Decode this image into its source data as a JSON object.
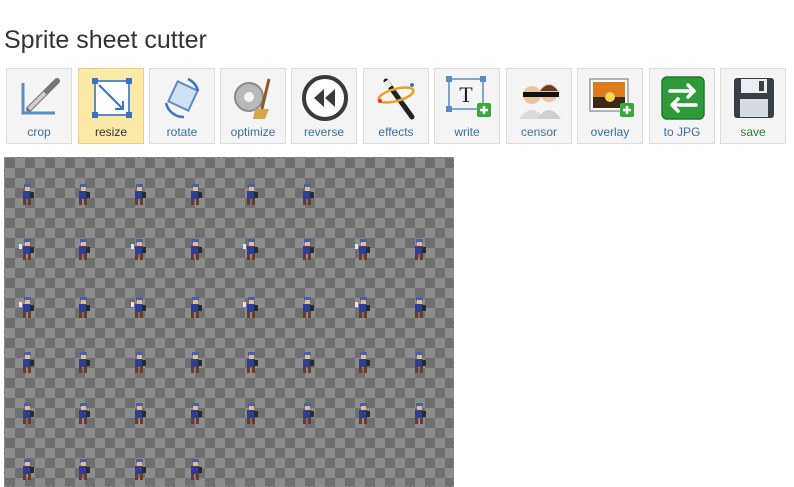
{
  "page": {
    "title": "Sprite sheet cutter"
  },
  "toolbar": {
    "tools": [
      {
        "label": "crop",
        "icon": "crop-icon",
        "active": false
      },
      {
        "label": "resize",
        "icon": "resize-icon",
        "active": true
      },
      {
        "label": "rotate",
        "icon": "rotate-icon",
        "active": false
      },
      {
        "label": "optimize",
        "icon": "optimize-icon",
        "active": false
      },
      {
        "label": "reverse",
        "icon": "reverse-icon",
        "active": false
      },
      {
        "label": "effects",
        "icon": "effects-icon",
        "active": false
      },
      {
        "label": "write",
        "icon": "write-icon",
        "active": false
      },
      {
        "label": "censor",
        "icon": "censor-icon",
        "active": false
      },
      {
        "label": "overlay",
        "icon": "overlay-icon",
        "active": false
      },
      {
        "label": "to JPG",
        "icon": "to-jpg-icon",
        "active": false
      },
      {
        "label": "save",
        "icon": "save-icon",
        "active": false
      }
    ]
  },
  "sprite_sheet": {
    "rows": [
      6,
      8,
      8,
      8,
      8,
      4
    ],
    "colors": {
      "hair": "#4a5fa8",
      "body": "#2f3f8f",
      "skin": "#e8b890",
      "boots": "#6b3a2a",
      "blade": "#dfe8f2"
    }
  },
  "colors": {
    "active_bg": "#fbe9a8",
    "link": "#3a6f9e",
    "save": "#2e7d32"
  }
}
